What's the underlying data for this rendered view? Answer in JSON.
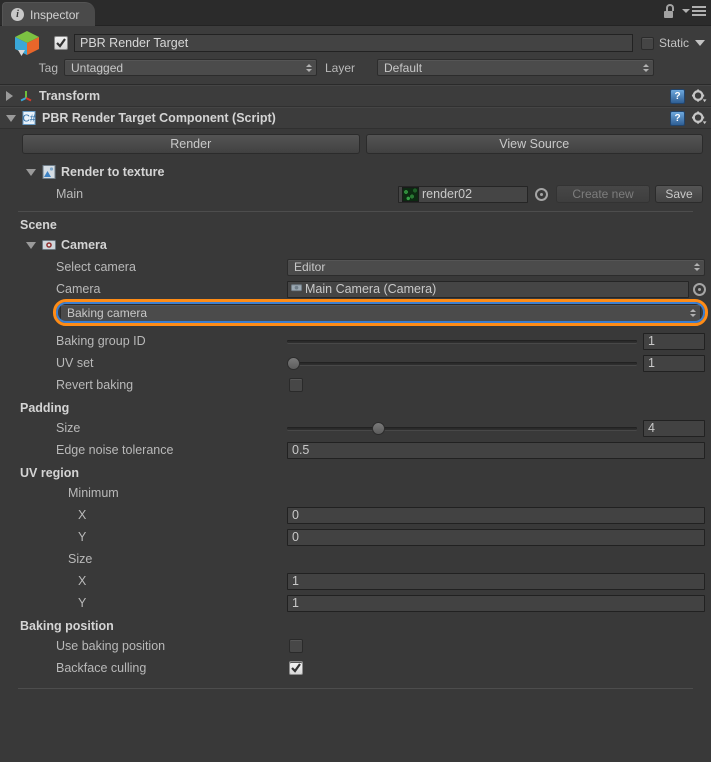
{
  "window": {
    "tab_label": "Inspector",
    "tab_icon": "info-icon",
    "lock_icon": "lock-open-icon",
    "menu_icon": "hamburger-menu-icon"
  },
  "object_header": {
    "enabled": true,
    "name_value": "PBR Render Target",
    "prefab_icon": "cube-prefab-icon",
    "static_label": "Static",
    "static_checked": false,
    "tag_label": "Tag",
    "tag_value": "Untagged",
    "layer_label": "Layer",
    "layer_value": "Default"
  },
  "components": [
    {
      "title": "Transform",
      "expanded": false,
      "icon": "transform-axis-icon",
      "help_icon": "help-book-icon",
      "gear_icon": "gear-icon"
    },
    {
      "title": "PBR Render Target Component (Script)",
      "expanded": true,
      "icon": "csharp-script-icon",
      "help_icon": "help-book-icon",
      "gear_icon": "gear-icon"
    }
  ],
  "toolbar": {
    "render_label": "Render",
    "view_source_label": "View Source"
  },
  "render_to_texture": {
    "title": "Render to texture",
    "expanded": true,
    "icon": "texture-icon",
    "main_label": "Main",
    "main_value": "render02",
    "main_thumb": "render-texture-thumbnail",
    "create_new_label": "Create new",
    "create_new_enabled": false,
    "save_label": "Save",
    "save_enabled": true
  },
  "scene": {
    "title": "Scene",
    "camera_group": {
      "title": "Camera",
      "expanded": true,
      "icon": "camera-icon",
      "select_camera_label": "Select camera",
      "select_camera_value": "Editor",
      "camera_label": "Camera",
      "camera_value": "Main Camera (Camera)",
      "camera_object_icon": "camera-object-icon",
      "baking_camera_value": "Baking camera",
      "baking_camera_highlighted": true,
      "highlight_color": "#ff8c16",
      "highlight_inner_color": "#3d7fd0"
    },
    "baking_group_id_label": "Baking group ID",
    "baking_group_id_value": "1",
    "baking_group_id_slider_pct": 0,
    "baking_group_id_handle_visible": false,
    "uv_set_label": "UV set",
    "uv_set_value": "1",
    "uv_set_slider_pct": 1,
    "revert_baking_label": "Revert baking",
    "revert_baking_checked": false
  },
  "padding": {
    "title": "Padding",
    "size_label": "Size",
    "size_value": "4",
    "size_slider_pct": 26,
    "edge_noise_label": "Edge noise tolerance",
    "edge_noise_value": "0.5"
  },
  "uv_region": {
    "title": "UV region",
    "minimum_label": "Minimum",
    "minimum_x_label": "X",
    "minimum_x_value": "0",
    "minimum_y_label": "Y",
    "minimum_y_value": "0",
    "size_label": "Size",
    "size_x_label": "X",
    "size_x_value": "1",
    "size_y_label": "Y",
    "size_y_value": "1"
  },
  "baking_position": {
    "title": "Baking position",
    "use_baking_position_label": "Use baking position",
    "use_baking_position_checked": false,
    "backface_culling_label": "Backface culling",
    "backface_culling_checked": true
  }
}
